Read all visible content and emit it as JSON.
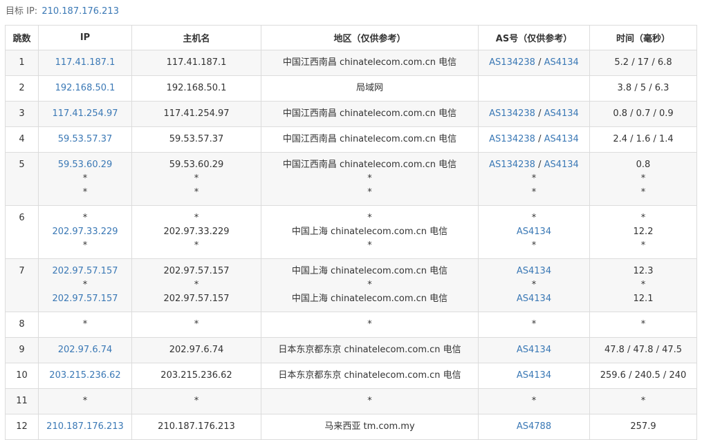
{
  "target": {
    "label": "目标 IP:",
    "ip": "210.187.176.213"
  },
  "columns": [
    "跳数",
    "IP",
    "主机名",
    "地区（仅供参考）",
    "AS号（仅供参考）",
    "时间（毫秒）"
  ],
  "colors": {
    "link": "#3a78b5",
    "stripe": "#f7f7f7",
    "border": "#dcdcdc"
  },
  "rows": [
    {
      "hop": "1",
      "ip": [
        "117.41.187.1"
      ],
      "host": [
        "117.41.187.1"
      ],
      "region": [
        "中国江西南昌 chinatelecom.com.cn 电信"
      ],
      "as": [
        [
          "AS134238",
          "AS4134"
        ]
      ],
      "time": [
        "5.2 / 17 / 6.8"
      ]
    },
    {
      "hop": "2",
      "ip": [
        "192.168.50.1"
      ],
      "host": [
        "192.168.50.1"
      ],
      "region": [
        "局域网"
      ],
      "as": [
        []
      ],
      "time": [
        "3.8 / 5 / 6.3"
      ]
    },
    {
      "hop": "3",
      "ip": [
        "117.41.254.97"
      ],
      "host": [
        "117.41.254.97"
      ],
      "region": [
        "中国江西南昌 chinatelecom.com.cn 电信"
      ],
      "as": [
        [
          "AS134238",
          "AS4134"
        ]
      ],
      "time": [
        "0.8 / 0.7 / 0.9"
      ]
    },
    {
      "hop": "4",
      "ip": [
        "59.53.57.37"
      ],
      "host": [
        "59.53.57.37"
      ],
      "region": [
        "中国江西南昌 chinatelecom.com.cn 电信"
      ],
      "as": [
        [
          "AS134238",
          "AS4134"
        ]
      ],
      "time": [
        "2.4 / 1.6 / 1.4"
      ]
    },
    {
      "hop": "5",
      "ip": [
        "59.53.60.29",
        "*",
        "*"
      ],
      "host": [
        "59.53.60.29",
        "*",
        "*"
      ],
      "region": [
        "中国江西南昌 chinatelecom.com.cn 电信",
        "*",
        "*"
      ],
      "as": [
        [
          "AS134238",
          "AS4134"
        ],
        [
          "*"
        ],
        [
          "*"
        ]
      ],
      "time": [
        "0.8",
        "*",
        "*"
      ]
    },
    {
      "hop": "6",
      "ip": [
        "*",
        "202.97.33.229",
        "*"
      ],
      "host": [
        "*",
        "202.97.33.229",
        "*"
      ],
      "region": [
        "*",
        "中国上海 chinatelecom.com.cn 电信",
        "*"
      ],
      "as": [
        [
          "*"
        ],
        [
          "AS4134"
        ],
        [
          "*"
        ]
      ],
      "time": [
        "*",
        "12.2",
        "*"
      ]
    },
    {
      "hop": "7",
      "ip": [
        "202.97.57.157",
        "*",
        "202.97.57.157"
      ],
      "host": [
        "202.97.57.157",
        "*",
        "202.97.57.157"
      ],
      "region": [
        "中国上海 chinatelecom.com.cn 电信",
        "*",
        "中国上海 chinatelecom.com.cn 电信"
      ],
      "as": [
        [
          "AS4134"
        ],
        [
          "*"
        ],
        [
          "AS4134"
        ]
      ],
      "time": [
        "12.3",
        "*",
        "12.1"
      ]
    },
    {
      "hop": "8",
      "ip": [
        "*"
      ],
      "host": [
        "*"
      ],
      "region": [
        "*"
      ],
      "as": [
        [
          "*"
        ]
      ],
      "time": [
        "*"
      ]
    },
    {
      "hop": "9",
      "ip": [
        "202.97.6.74"
      ],
      "host": [
        "202.97.6.74"
      ],
      "region": [
        "日本东京都东京 chinatelecom.com.cn 电信"
      ],
      "as": [
        [
          "AS4134"
        ]
      ],
      "time": [
        "47.8 / 47.8 / 47.5"
      ]
    },
    {
      "hop": "10",
      "ip": [
        "203.215.236.62"
      ],
      "host": [
        "203.215.236.62"
      ],
      "region": [
        "日本东京都东京 chinatelecom.com.cn 电信"
      ],
      "as": [
        [
          "AS4134"
        ]
      ],
      "time": [
        "259.6 / 240.5 / 240"
      ]
    },
    {
      "hop": "11",
      "ip": [
        "*"
      ],
      "host": [
        "*"
      ],
      "region": [
        "*"
      ],
      "as": [
        [
          "*"
        ]
      ],
      "time": [
        "*"
      ]
    },
    {
      "hop": "12",
      "ip": [
        "210.187.176.213"
      ],
      "host": [
        "210.187.176.213"
      ],
      "region": [
        "马来西亚 tm.com.my"
      ],
      "as": [
        [
          "AS4788"
        ]
      ],
      "time": [
        "257.9"
      ]
    }
  ]
}
